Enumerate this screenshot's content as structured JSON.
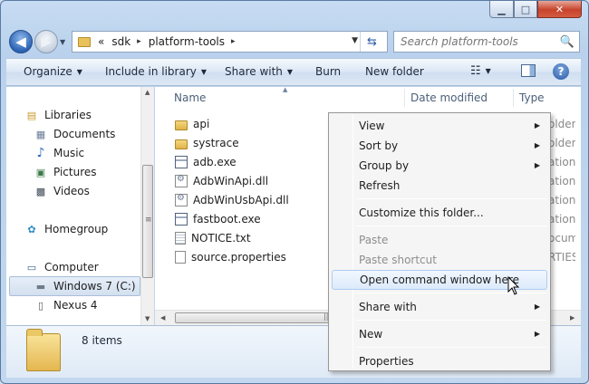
{
  "window": {
    "caption_buttons": {
      "minimize": "▁",
      "maximize": "□",
      "close": "✕"
    }
  },
  "nav": {
    "back_glyph": "◀",
    "forward_glyph": "▶",
    "dropdown_glyph": "▼"
  },
  "address": {
    "overflow": "«",
    "crumbs": [
      "sdk",
      "platform-tools"
    ],
    "separator": "▸",
    "dropdown_glyph": "▼",
    "refresh_glyph": "⇆"
  },
  "search": {
    "placeholder": "Search platform-tools",
    "icon": "🔍"
  },
  "toolbar": {
    "organize": "Organize",
    "include_in_library": "Include in library",
    "share_with": "Share with",
    "burn": "Burn",
    "new_folder": "New folder",
    "dropdown_glyph": "▼",
    "views_glyph": "☷",
    "help_glyph": "?"
  },
  "sidebar": {
    "items": [
      {
        "label": "Libraries",
        "icon": "libraries-icon",
        "glyph": "▤"
      },
      {
        "label": "Documents",
        "icon": "documents-icon",
        "glyph": "▦"
      },
      {
        "label": "Music",
        "icon": "music-icon",
        "glyph": "♪"
      },
      {
        "label": "Pictures",
        "icon": "pictures-icon",
        "glyph": "▣"
      },
      {
        "label": "Videos",
        "icon": "videos-icon",
        "glyph": "▩"
      },
      {
        "label": "Homegroup",
        "icon": "homegroup-icon",
        "glyph": "✿"
      },
      {
        "label": "Computer",
        "icon": "computer-icon",
        "glyph": "▭"
      },
      {
        "label": "Windows 7 (C:)",
        "icon": "drive-icon",
        "glyph": "▬"
      },
      {
        "label": "Nexus 4",
        "icon": "phone-icon",
        "glyph": "▯"
      }
    ]
  },
  "columns": {
    "name": "Name",
    "date_modified": "Date modified",
    "type": "Type",
    "sort_glyph": "▲"
  },
  "files": [
    {
      "name": "api",
      "kind": "folder",
      "type_trunc": "older"
    },
    {
      "name": "systrace",
      "kind": "folder",
      "type_trunc": "older"
    },
    {
      "name": "adb.exe",
      "kind": "exe",
      "type_trunc": "ation"
    },
    {
      "name": "AdbWinApi.dll",
      "kind": "dll",
      "type_trunc": "ation e"
    },
    {
      "name": "AdbWinUsbApi.dll",
      "kind": "dll",
      "type_trunc": "ation e"
    },
    {
      "name": "fastboot.exe",
      "kind": "exe",
      "type_trunc": "ation"
    },
    {
      "name": "NOTICE.txt",
      "kind": "txt",
      "type_trunc": "ocume"
    },
    {
      "name": "source.properties",
      "kind": "file",
      "type_trunc": "RTIES"
    }
  ],
  "scroll": {
    "up": "▲",
    "down": "▼",
    "left": "◀",
    "right": "▶",
    "grip": "≡",
    "hgrip": "|||"
  },
  "details": {
    "count": "8 items"
  },
  "context_menu": {
    "view": "View",
    "sort_by": "Sort by",
    "group_by": "Group by",
    "refresh": "Refresh",
    "customize": "Customize this folder...",
    "paste": "Paste",
    "paste_shortcut": "Paste shortcut",
    "open_cmd": "Open command window here",
    "share_with": "Share with",
    "new": "New",
    "properties": "Properties",
    "submenu_glyph": "▶"
  }
}
